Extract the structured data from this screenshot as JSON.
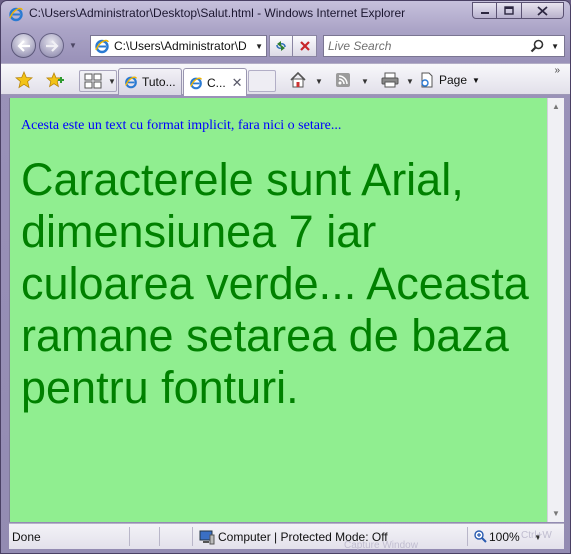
{
  "window": {
    "title": "C:\\Users\\Administrator\\Desktop\\Salut.html - Windows Internet Explorer"
  },
  "address_bar": {
    "url": "C:\\Users\\Administrator\\D"
  },
  "search": {
    "placeholder": "Live Search"
  },
  "tabs": [
    {
      "label": "Tuto..."
    },
    {
      "label": "C..."
    }
  ],
  "commands": {
    "page_label": "Page"
  },
  "content": {
    "small_text": "Acesta este un text cu format implicit, fara nici o setare...",
    "big_text": "Caracterele sunt Arial, dimensiunea 7 iar culoarea verde... Aceasta ramane setarea de baza pentru fonturi.",
    "background_color": "#90ee90",
    "small_text_color": "#0000ff",
    "big_text_color": "#008000"
  },
  "status": {
    "left": "Done",
    "zone": "Computer | Protected Mode: Off",
    "zoom": "100%",
    "watermark": "Capture Window",
    "watermark_right": "Ctrl+W"
  },
  "icons": [
    "ie-icon",
    "minimize-icon",
    "maximize-icon",
    "close-icon",
    "back-icon",
    "forward-icon",
    "refresh-icon",
    "stop-icon",
    "search-icon",
    "favorites-star-icon",
    "add-favorites-icon",
    "quick-tabs-icon",
    "home-icon",
    "feeds-icon",
    "print-icon",
    "page-icon",
    "computer-zone-icon",
    "zoom-icon"
  ]
}
